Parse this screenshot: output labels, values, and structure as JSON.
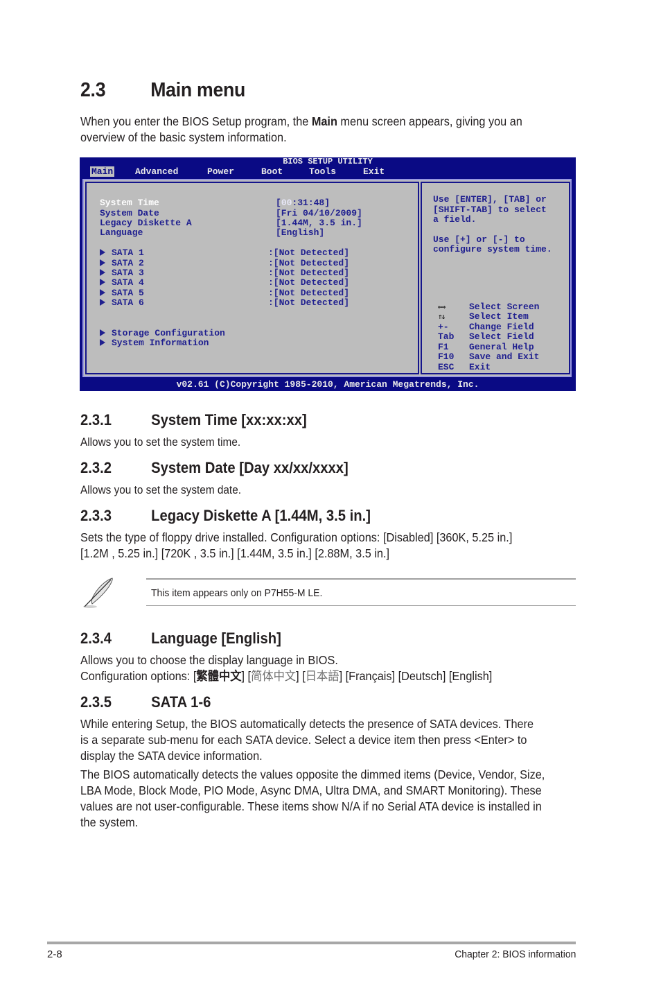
{
  "heading": {
    "number": "2.3",
    "title": "Main menu"
  },
  "intro": {
    "part1": "When you enter the BIOS Setup program, the ",
    "bold": "Main",
    "part2": " menu screen appears, giving you an",
    "line2": "overview of the basic system information."
  },
  "bios": {
    "title": "BIOS SETUP UTILITY",
    "menu": [
      {
        "label": "Main",
        "active": true
      },
      {
        "label": "Advanced",
        "active": false
      },
      {
        "label": "Power",
        "active": false
      },
      {
        "label": "Boot",
        "active": false
      },
      {
        "label": "Tools",
        "active": false
      },
      {
        "label": "Exit",
        "active": false
      }
    ],
    "fields": [
      {
        "label": "System Time",
        "value_prefix": "[",
        "value_highlight": "00",
        "value_rest": ":31:48]",
        "selected": true
      },
      {
        "label": "System Date",
        "value": "[Fri 04/10/2009]"
      },
      {
        "label": "Legacy Diskette A",
        "value": "[1.44M, 3.5 in.]"
      },
      {
        "label": "Language",
        "value": "[English]"
      }
    ],
    "sata": [
      {
        "label": "SATA 1",
        "value": ":[Not Detected]"
      },
      {
        "label": "SATA 2",
        "value": ":[Not Detected]"
      },
      {
        "label": "SATA 3",
        "value": ":[Not Detected]"
      },
      {
        "label": "SATA 4",
        "value": ":[Not Detected]"
      },
      {
        "label": "SATA 5",
        "value": ":[Not Detected]"
      },
      {
        "label": "SATA 6",
        "value": ":[Not Detected]"
      }
    ],
    "submenus": [
      "Storage Configuration",
      "System Information"
    ],
    "help": [
      "Use [ENTER], [TAB] or",
      "[SHIFT-TAB] to select",
      "a field.",
      "",
      "Use [+] or [-] to",
      "configure system time."
    ],
    "keys": [
      {
        "key": "left-right-arrows",
        "action": "Select Screen"
      },
      {
        "key": "up-down-arrows",
        "action": "Select Item"
      },
      {
        "key": "+-",
        "action": "Change Field"
      },
      {
        "key": "Tab",
        "action": "Select Field"
      },
      {
        "key": "F1",
        "action": "General Help"
      },
      {
        "key": "F10",
        "action": "Save and Exit"
      },
      {
        "key": "ESC",
        "action": "Exit"
      }
    ],
    "footer": "v02.61 (C)Copyright 1985-2010, American Megatrends, Inc.",
    "colors": {
      "background": "#0a0a84",
      "panel": "#bdbdbd",
      "text": "#1f1f8f"
    }
  },
  "sections": [
    {
      "number": "2.3.1",
      "title": "System Time [xx:xx:xx]",
      "body": [
        "Allows you to set the system time."
      ]
    },
    {
      "number": "2.3.2",
      "title": "System Date [Day xx/xx/xxxx]",
      "body": [
        "Allows you to set the system date."
      ]
    },
    {
      "number": "2.3.3",
      "title": "Legacy Diskette A [1.44M, 3.5 in.]",
      "body": [
        "Sets the type of floppy drive installed. Configuration options: [Disabled] [360K, 5.25 in.]",
        "[1.2M , 5.25 in.] [720K , 3.5 in.] [1.44M, 3.5 in.] [2.88M, 3.5 in.]"
      ]
    },
    {
      "number": "2.3.4",
      "title": "Language [English]",
      "body": [
        "Allows you to choose the display language in BIOS."
      ],
      "options_prefix": "Configuration options: ",
      "options": [
        "繁體中文",
        "简体中文",
        "日本語",
        "Français",
        "Deutsch",
        "English"
      ]
    },
    {
      "number": "2.3.5",
      "title": "SATA 1-6",
      "body": [
        "While entering Setup, the BIOS automatically detects the presence of SATA devices. There",
        "is a separate sub-menu for each SATA device. Select a device item then press <Enter> to",
        "display the SATA device information.",
        "The BIOS automatically detects the values opposite the dimmed items (Device, Vendor, Size,",
        "LBA Mode, Block Mode, PIO Mode, Async DMA, Ultra DMA, and SMART Monitoring). These",
        "values are not user-configurable. These items show N/A if no Serial ATA device is installed in",
        "the system."
      ]
    }
  ],
  "note": {
    "icon": "feather-pen-icon",
    "text": "This item appears only on P7H55-M LE."
  },
  "footer": {
    "page": "2-8",
    "chapter": "Chapter 2: BIOS information"
  }
}
